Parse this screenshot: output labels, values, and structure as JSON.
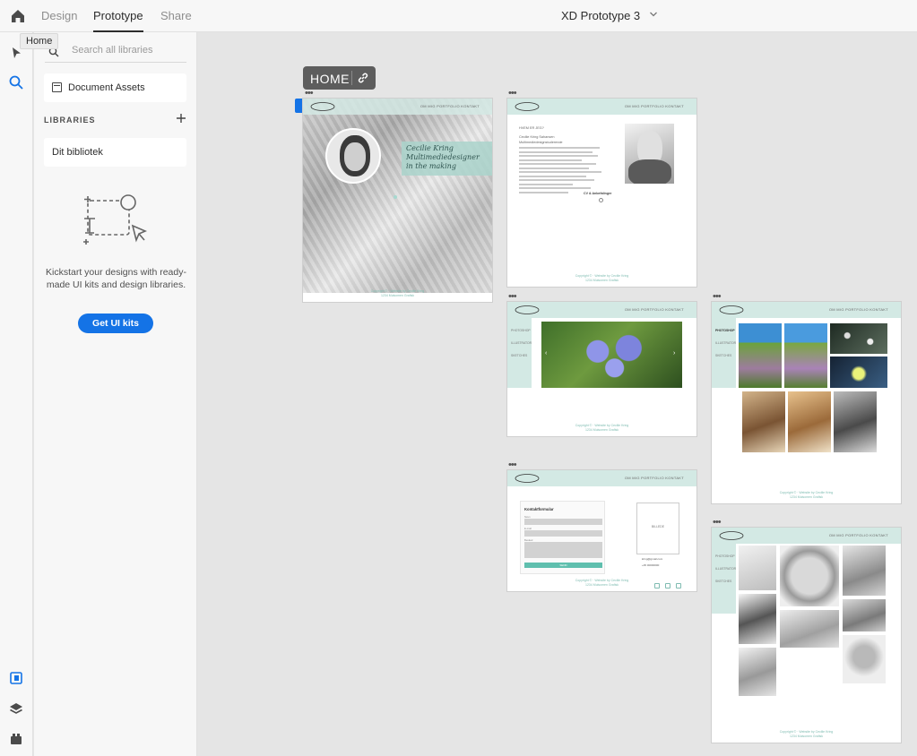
{
  "topbar": {
    "tabs": [
      "Design",
      "Prototype",
      "Share"
    ],
    "active_tab": "Prototype",
    "document_title": "XD Prototype 3"
  },
  "rail": {
    "tooltip": "Home"
  },
  "libraries_panel": {
    "search_placeholder": "Search all libraries",
    "document_assets": "Document Assets",
    "libraries_heading": "LIBRARIES",
    "library_item": "Dit bibliotek",
    "kickstart_text": "Kickstart your designs with ready-made UI kits and design libraries.",
    "cta_label": "Get UI kits"
  },
  "canvas": {
    "home_label": "HOME",
    "artboards": {
      "nav": "OM MIG    PORTFOLIO    KONTAKT",
      "footer": "Copyright © · Website by Cecilie Kring",
      "footer2": "1234 Mulsomen Grafisk",
      "home_title": "Cecilie Kring",
      "home_sub1": "Multimediedesigner",
      "home_sub2": "in the making",
      "about_heading": "HVEM ER JEG?",
      "about_line1": "Cecilie Kring Sahansen",
      "about_line2": "Multimediedesignstuderende",
      "about_cv": "CV & Anbefalinger",
      "side_items": [
        "PHOTOSHOP",
        "ILLUSTRATOR",
        "SKETCHES"
      ],
      "contact_title": "Kontaktformular",
      "contact_fields": [
        "Navn",
        "E-mail",
        "Besked"
      ],
      "contact_send": "SEND",
      "contact_email": "kring@gmail.com",
      "contact_phone": "+45 00000000",
      "contact_photo": "BILLEDE"
    }
  },
  "colors": {
    "accent_blue": "#1473e6",
    "board_mint": "#d3e9e4",
    "teal_button": "#5fbfae"
  }
}
